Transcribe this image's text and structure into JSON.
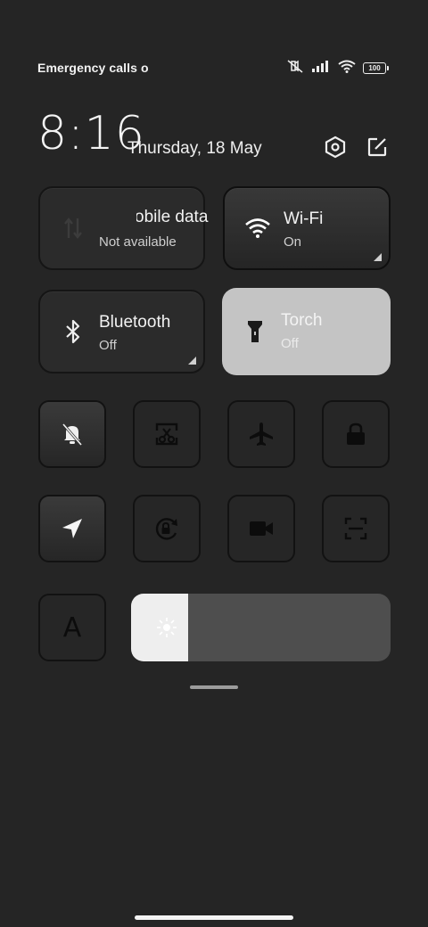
{
  "status_bar": {
    "carrier_text": "Emergency calls o",
    "battery_level": "100",
    "icons": [
      "mute-icon",
      "signal-icon",
      "wifi-icon",
      "battery-icon"
    ]
  },
  "header": {
    "time": "8:16",
    "date": "Thursday, 18 May",
    "settings_icon": "hexagon-settings-icon",
    "edit_icon": "edit-icon"
  },
  "tiles": {
    "mobile_data": {
      "label": "obile data",
      "label_full": "Mobile data",
      "status": "Not available",
      "icon": "mobile-data-arrows-icon"
    },
    "wifi": {
      "label": "Wi-Fi",
      "status": "On",
      "icon": "wifi-icon"
    },
    "bluetooth": {
      "label": "Bluetooth",
      "status": "Off",
      "icon": "bluetooth-icon"
    },
    "torch": {
      "label": "Torch",
      "status": "Off",
      "icon": "torch-icon"
    }
  },
  "toggles_row1": [
    "mute-bell-icon",
    "screenshot-icon",
    "airplane-icon",
    "lock-icon"
  ],
  "toggles_row2": [
    "location-icon",
    "rotation-lock-icon",
    "video-icon",
    "scan-icon"
  ],
  "reading_mode_label": "A",
  "brightness": {
    "level": 0.22,
    "icon": "sun-icon"
  },
  "colors": {
    "background": "#252525",
    "torch_active": "#c4c4c4",
    "slider_fill": "#eeeeee",
    "slider_track": "#4e4e4e"
  }
}
